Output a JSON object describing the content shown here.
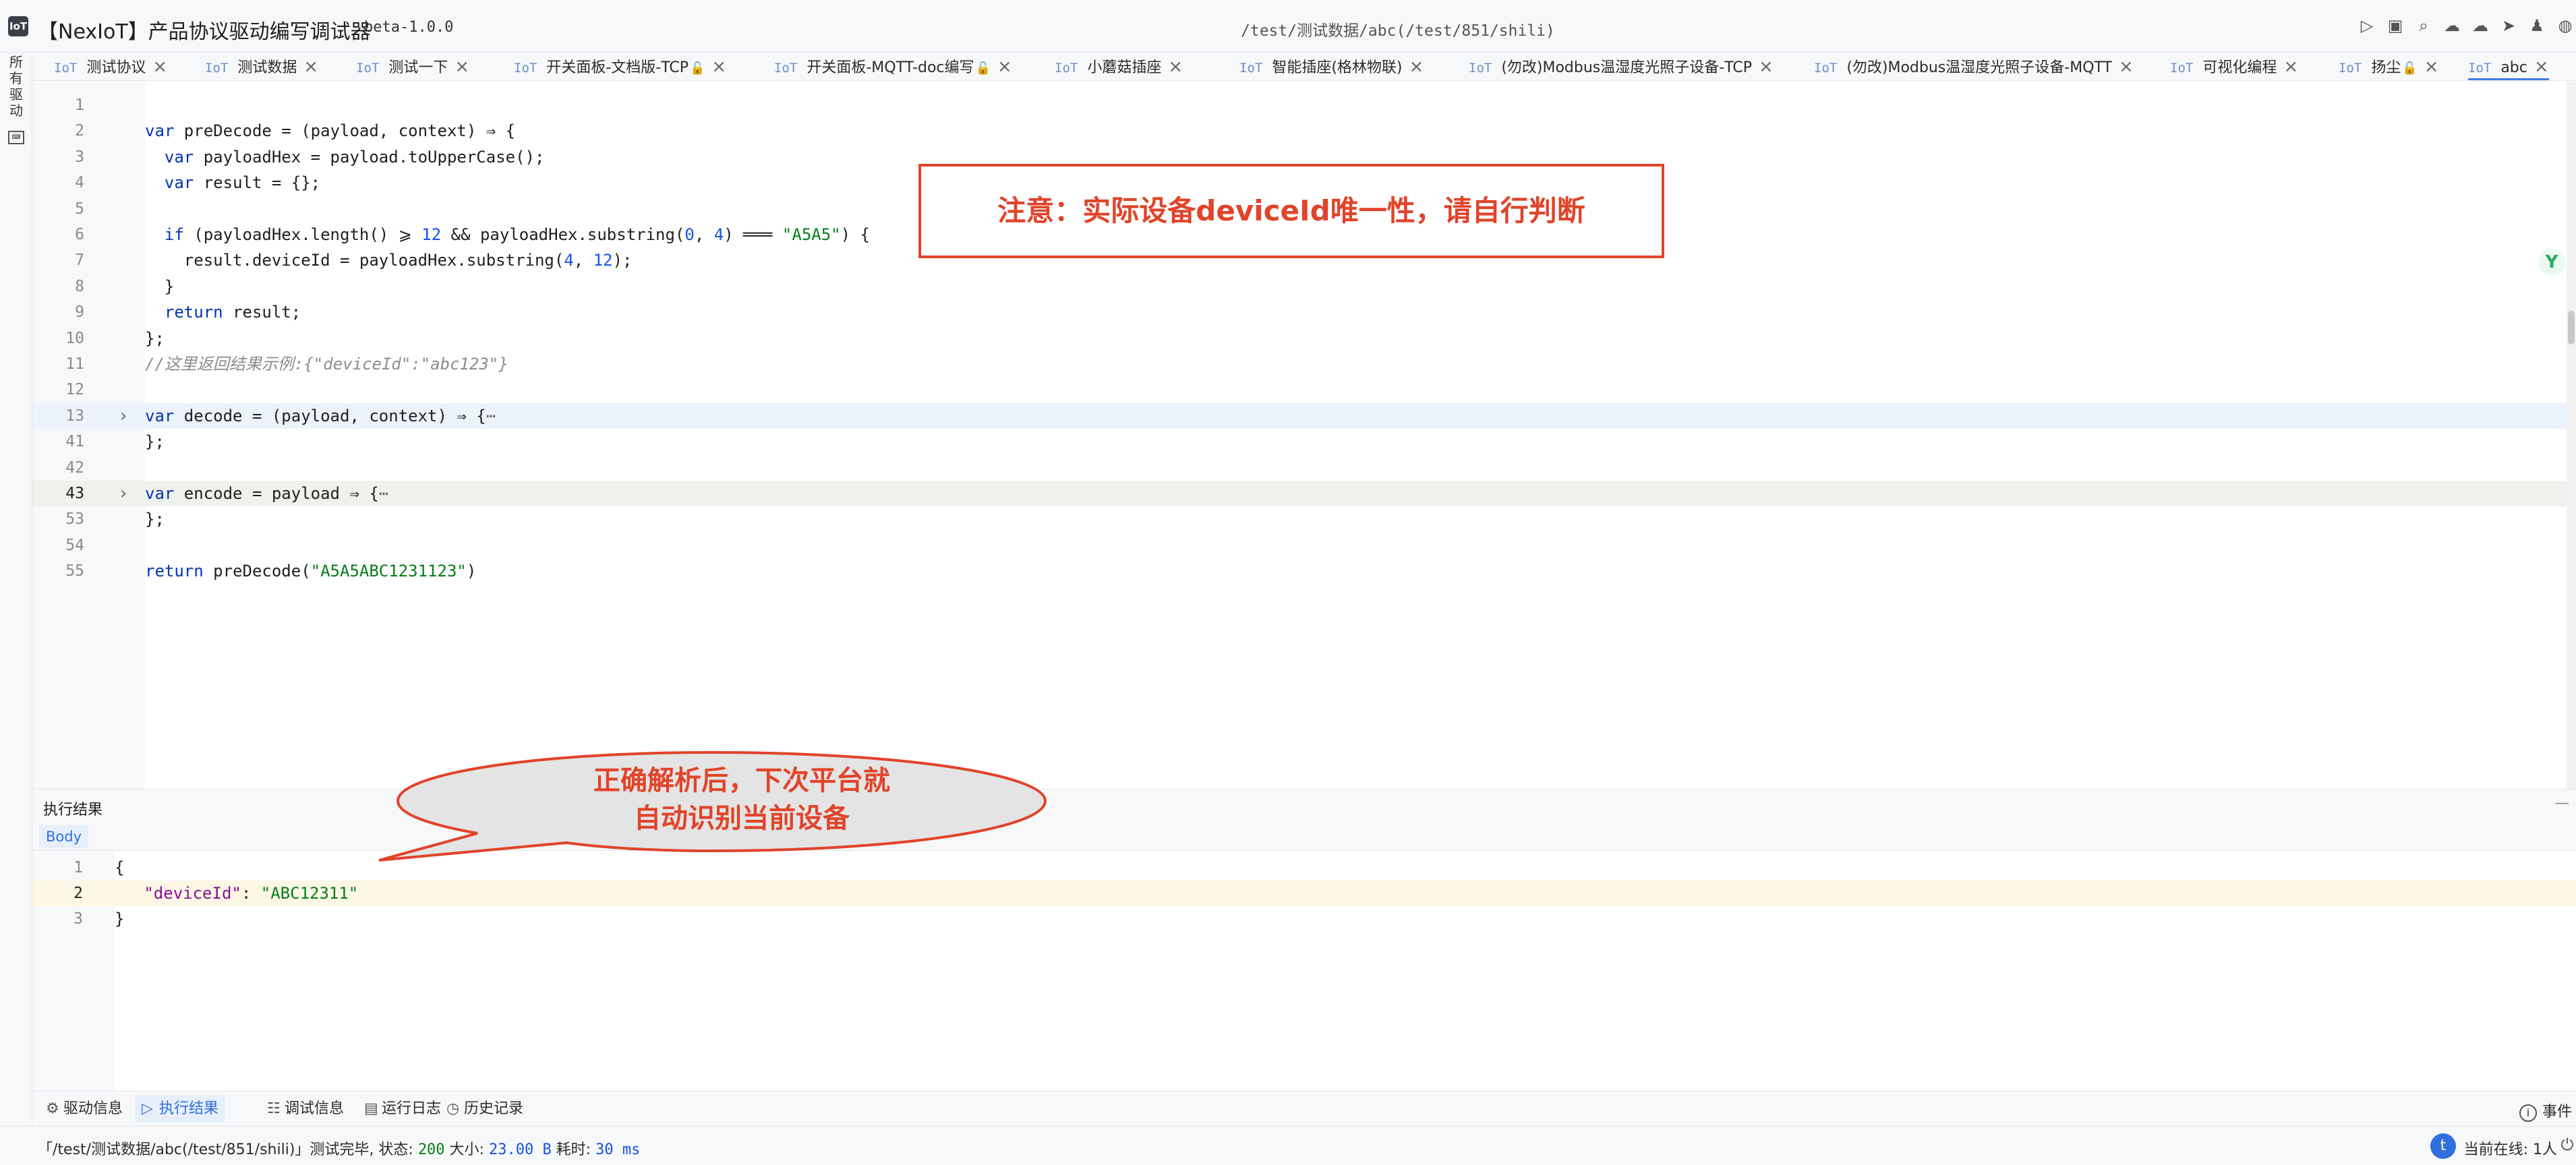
{
  "titlebar": {
    "logo": "IoT",
    "title": "【NexIoT】产品协议驱动编写调试器",
    "version": "beta-1.0.0",
    "path": "/test/测试数据/abc(/test/851/shili)",
    "icons": [
      "run-icon",
      "save-icon",
      "search-icon",
      "cloud-upload-icon",
      "cloud-download-icon",
      "send-icon",
      "shirt-icon",
      "globe-icon"
    ]
  },
  "sidebar": {
    "label": "所有驱动"
  },
  "tabs": [
    {
      "prefix": "IoT",
      "label": "测试协议",
      "locked": false,
      "closable": true,
      "active": false
    },
    {
      "prefix": "IoT",
      "label": "测试数据",
      "locked": false,
      "closable": true,
      "active": false
    },
    {
      "prefix": "IoT",
      "label": "测试一下",
      "locked": false,
      "closable": true,
      "active": false
    },
    {
      "prefix": "IoT",
      "label": "开关面板-文档版-TCP",
      "locked": true,
      "closable": true,
      "active": false
    },
    {
      "prefix": "IoT",
      "label": "开关面板-MQTT-doc编写",
      "locked": true,
      "closable": true,
      "active": false
    },
    {
      "prefix": "IoT",
      "label": "小蘑菇插座",
      "locked": false,
      "closable": true,
      "active": false
    },
    {
      "prefix": "IoT",
      "label": "智能插座(格林物联)",
      "locked": false,
      "closable": true,
      "active": false
    },
    {
      "prefix": "IoT",
      "label": "(勿改)Modbus温湿度光照子设备-TCP",
      "locked": false,
      "closable": true,
      "active": false
    },
    {
      "prefix": "IoT",
      "label": "(勿改)Modbus温湿度光照子设备-MQTT",
      "locked": false,
      "closable": true,
      "active": false
    },
    {
      "prefix": "IoT",
      "label": "可视化编程",
      "locked": false,
      "closable": true,
      "active": false
    },
    {
      "prefix": "IoT",
      "label": "扬尘",
      "locked": true,
      "closable": true,
      "active": false
    },
    {
      "prefix": "IoT",
      "label": "abc",
      "locked": false,
      "closable": true,
      "active": true
    }
  ],
  "editor": {
    "lines": [
      {
        "n": "1",
        "code": ""
      },
      {
        "n": "2",
        "code": "var preDecode = (payload, context) ⇒ {"
      },
      {
        "n": "3",
        "code": "  var payloadHex = payload.toUpperCase();"
      },
      {
        "n": "4",
        "code": "  var result = {};"
      },
      {
        "n": "5",
        "code": ""
      },
      {
        "n": "6",
        "code": "  if (payloadHex.length() ⩾ 12 && payloadHex.substring(0, 4) ═══ \"A5A5\") {"
      },
      {
        "n": "7",
        "code": "    result.deviceId = payloadHex.substring(4, 12);"
      },
      {
        "n": "8",
        "code": "  }"
      },
      {
        "n": "9",
        "code": "  return result;"
      },
      {
        "n": "10",
        "code": "};"
      },
      {
        "n": "11",
        "code": "//这里返回结果示例:{\"deviceId\":\"abc123\"}"
      },
      {
        "n": "12",
        "code": ""
      },
      {
        "n": "13",
        "code": "var decode = (payload, context) ⇒ {⋯"
      },
      {
        "n": "41",
        "code": "};"
      },
      {
        "n": "42",
        "code": ""
      },
      {
        "n": "43",
        "code": "var encode = payload ⇒ {⋯"
      },
      {
        "n": "53",
        "code": "};"
      },
      {
        "n": "54",
        "code": ""
      },
      {
        "n": "55",
        "code": "return preDecode(\"A5A5ABC1231123\")"
      }
    ]
  },
  "annotations": {
    "note": "注意：实际设备deviceId唯一性，请自行判断",
    "bubble_line1": "正确解析后，下次平台就",
    "bubble_line2": "自动识别当前设备"
  },
  "result": {
    "title": "执行结果",
    "collapse": "—",
    "body_tab": "Body",
    "lines": [
      {
        "n": "1",
        "code": "{"
      },
      {
        "n": "2",
        "key": "\"deviceId\"",
        "value": "\"ABC12311\""
      },
      {
        "n": "3",
        "code": "}"
      }
    ]
  },
  "tool_tabs": [
    {
      "icon": "driver-info-icon",
      "glyph": "⚙",
      "label": "驱动信息",
      "active": false
    },
    {
      "icon": "run-result-icon",
      "glyph": "▷",
      "label": "执行结果",
      "active": true
    },
    {
      "icon": "debug-info-icon",
      "glyph": "☷",
      "label": "调试信息",
      "active": false
    },
    {
      "icon": "run-log-icon",
      "glyph": "▤",
      "label": "运行日志",
      "active": false
    },
    {
      "icon": "history-icon",
      "glyph": "◷",
      "label": "历史记录",
      "active": false
    }
  ],
  "event_tab": "事件",
  "status": {
    "prefix": "「/test/测试数据/abc(/test/851/shili)」测试完毕, 状态: ",
    "code": "200",
    "size_label": " 大小: ",
    "size": "23.00 B",
    "time_label": " 耗时: ",
    "time": "30 ms",
    "avatar": "t",
    "online": "当前在线: 1人"
  }
}
